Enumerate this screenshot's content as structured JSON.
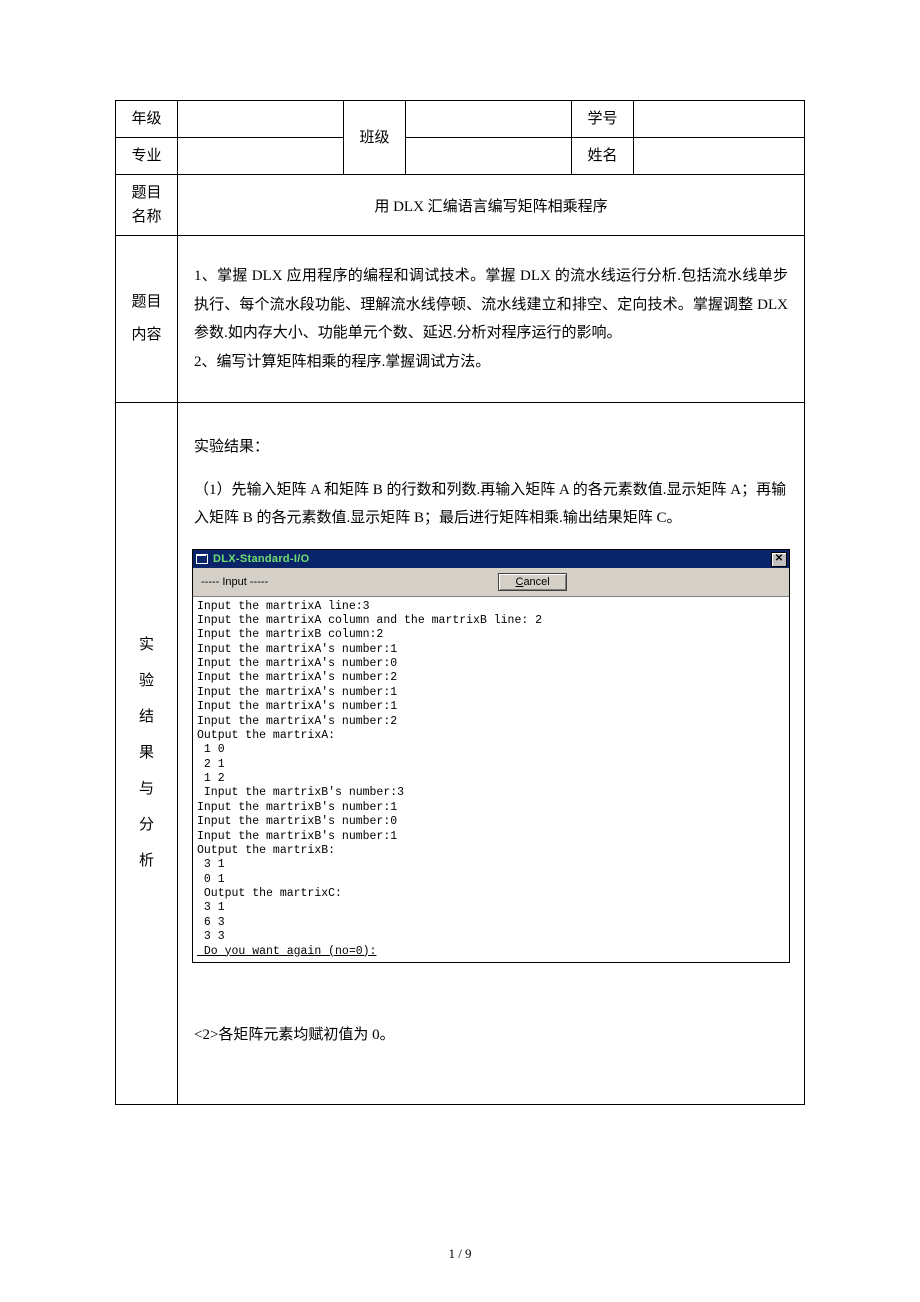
{
  "header": {
    "grade_label": "年级",
    "class_label": "班级",
    "id_label": "学号",
    "major_label": "专业",
    "name_label": "姓名",
    "grade_value": "",
    "class_value": "",
    "id_value": "",
    "major_value": "",
    "name_value": ""
  },
  "title_row": {
    "label": "题目名称",
    "value": "用 DLX 汇编语言编写矩阵相乘程序"
  },
  "content_row": {
    "label": "题目内容",
    "text": "1、掌握 DLX 应用程序的编程和调试技术。掌握 DLX 的流水线运行分析.包括流水线单步执行、每个流水段功能、理解流水线停顿、流水线建立和排空、定向技术。掌握调整 DLX 参数.如内存大小、功能单元个数、延迟.分析对程序运行的影响。\n2、编写计算矩阵相乘的程序.掌握调试方法。"
  },
  "result_row": {
    "label": "实验结果与分析",
    "intro_heading": "实验结果：",
    "intro_para": "（1）先输入矩阵 A 和矩阵 B 的行数和列数.再输入矩阵 A 的各元素数值.显示矩阵 A；再输入矩阵 B 的各元素数值.显示矩阵 B；最后进行矩阵相乘.输出结果矩阵 C。",
    "note2": "<2>各矩阵元素均赋初值为 0。"
  },
  "io_window": {
    "title": "DLX-Standard-I/O",
    "input_label": "----- Input -----",
    "cancel_label": "Cancel",
    "lines": [
      "Input the martrixA line:3",
      "Input the martrixA column and the martrixB line: 2",
      "Input the martrixB column:2",
      "Input the martrixA's number:1",
      "Input the martrixA's number:0",
      "Input the martrixA's number:2",
      "Input the martrixA's number:1",
      "Input the martrixA's number:1",
      "Input the martrixA's number:2",
      "Output the martrixA:",
      " 1 0",
      " 2 1",
      " 1 2",
      " Input the martrixB's number:3",
      "Input the martrixB's number:1",
      "Input the martrixB's number:0",
      "Input the martrixB's number:1",
      "Output the martrixB:",
      " 3 1",
      " 0 1",
      " Output the martrixC:",
      " 3 1",
      " 6 3",
      " 3 3"
    ],
    "last_line": " Do you want again (no=0):"
  },
  "footer": "1 / 9"
}
